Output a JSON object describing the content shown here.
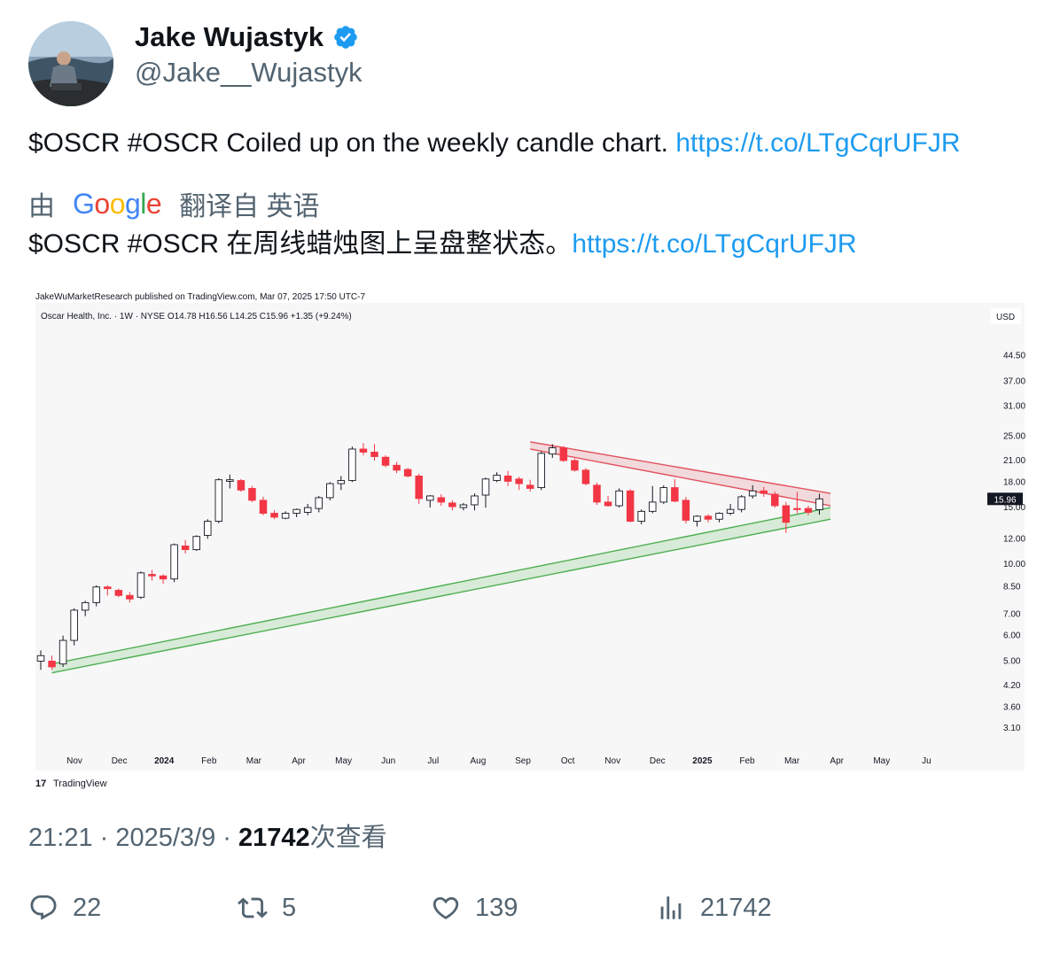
{
  "author": {
    "name": "Jake Wujastyk",
    "handle": "@Jake__Wujastyk",
    "verified": true,
    "avatar_icon": "profile-photo"
  },
  "tweet": {
    "text": "$OSCR #OSCR Coiled up on the weekly candle chart. ",
    "link": "https://t.co/LTgCqrUFJR"
  },
  "translation": {
    "prefix": "由",
    "provider": "Google",
    "suffix": "翻译自 英语",
    "text": "$OSCR #OSCR 在周线蜡烛图上呈盘整状态。",
    "link": "https://t.co/LTgCqrUFJR"
  },
  "chart_data": {
    "type": "candlestick",
    "publisher_line": "JakeWuMarketResearch published on TradingView.com, Mar 07, 2025 17:50 UTC-7",
    "symbol_line": "Oscar Health, Inc. · 1W · NYSE  O14.78  H16.56  L14.25  C15.96  +1.35 (+9.24%)",
    "currency": "USD",
    "last_price_label": "15.96",
    "y_scale": "log",
    "ylim": [
      2.8,
      55
    ],
    "y_ticks": [
      "44.50",
      "37.00",
      "31.00",
      "25.00",
      "21.00",
      "18.00",
      "15.00",
      "12.00",
      "10.00",
      "8.50",
      "7.00",
      "6.00",
      "5.00",
      "4.20",
      "3.60",
      "3.10"
    ],
    "x_ticks": [
      "Nov",
      "Dec",
      "2024",
      "Feb",
      "Mar",
      "Apr",
      "May",
      "Jun",
      "Jul",
      "Aug",
      "Sep",
      "Oct",
      "Nov",
      "Dec",
      "2025",
      "Feb",
      "Mar",
      "Apr",
      "May",
      "Ju"
    ],
    "candles": [
      [
        5.0,
        5.4,
        4.7,
        5.2
      ],
      [
        5.0,
        5.2,
        4.7,
        4.8
      ],
      [
        4.9,
        6.0,
        4.8,
        5.8
      ],
      [
        5.8,
        7.3,
        5.6,
        7.2
      ],
      [
        7.2,
        7.7,
        6.9,
        7.6
      ],
      [
        7.6,
        8.6,
        7.4,
        8.5
      ],
      [
        8.5,
        8.6,
        8.0,
        8.4
      ],
      [
        8.3,
        8.4,
        7.9,
        8.0
      ],
      [
        8.0,
        8.2,
        7.6,
        7.8
      ],
      [
        7.9,
        9.5,
        7.8,
        9.4
      ],
      [
        9.3,
        9.6,
        8.9,
        9.2
      ],
      [
        9.2,
        9.3,
        8.7,
        9.0
      ],
      [
        9.0,
        11.6,
        8.8,
        11.5
      ],
      [
        11.4,
        11.9,
        10.8,
        11.1
      ],
      [
        11.1,
        12.3,
        11.0,
        12.2
      ],
      [
        12.3,
        13.8,
        12.0,
        13.6
      ],
      [
        13.6,
        18.5,
        13.4,
        18.3
      ],
      [
        18.1,
        19.0,
        17.2,
        18.3
      ],
      [
        18.2,
        18.4,
        16.8,
        17.0
      ],
      [
        17.2,
        17.5,
        15.6,
        15.8
      ],
      [
        15.8,
        16.2,
        14.2,
        14.4
      ],
      [
        14.4,
        14.7,
        13.8,
        14.0
      ],
      [
        13.9,
        14.6,
        13.8,
        14.4
      ],
      [
        14.4,
        14.9,
        14.0,
        14.8
      ],
      [
        14.5,
        15.4,
        14.2,
        15.0
      ],
      [
        14.9,
        16.3,
        14.5,
        16.1
      ],
      [
        16.1,
        18.0,
        15.8,
        17.8
      ],
      [
        17.8,
        18.8,
        17.0,
        18.2
      ],
      [
        18.2,
        23.2,
        18.0,
        22.8
      ],
      [
        22.8,
        23.8,
        21.8,
        22.3
      ],
      [
        22.3,
        23.6,
        21.0,
        21.6
      ],
      [
        21.5,
        21.8,
        20.0,
        20.3
      ],
      [
        20.3,
        20.8,
        19.2,
        19.6
      ],
      [
        19.7,
        19.9,
        18.6,
        18.8
      ],
      [
        18.8,
        19.1,
        15.4,
        16.0
      ],
      [
        15.8,
        16.4,
        15.0,
        16.3
      ],
      [
        16.1,
        16.5,
        15.2,
        15.6
      ],
      [
        15.5,
        15.8,
        14.7,
        15.1
      ],
      [
        15.0,
        15.5,
        14.7,
        15.3
      ],
      [
        15.3,
        16.6,
        14.7,
        16.3
      ],
      [
        16.4,
        18.6,
        15.0,
        18.4
      ],
      [
        18.2,
        19.3,
        18.0,
        18.9
      ],
      [
        18.8,
        19.5,
        17.5,
        18.1
      ],
      [
        18.4,
        18.7,
        17.0,
        17.8
      ],
      [
        17.6,
        18.3,
        16.8,
        17.2
      ],
      [
        17.3,
        22.4,
        17.0,
        22.1
      ],
      [
        22.0,
        23.6,
        21.4,
        23.0
      ],
      [
        23.0,
        23.3,
        20.8,
        21.0
      ],
      [
        21.0,
        21.3,
        19.4,
        19.6
      ],
      [
        19.6,
        19.9,
        17.6,
        17.8
      ],
      [
        17.6,
        17.9,
        15.3,
        15.6
      ],
      [
        15.6,
        16.3,
        15.1,
        15.2
      ],
      [
        15.2,
        17.2,
        15.0,
        16.9
      ],
      [
        16.9,
        17.1,
        13.5,
        13.6
      ],
      [
        13.6,
        14.8,
        13.3,
        14.6
      ],
      [
        14.6,
        17.5,
        14.4,
        15.6
      ],
      [
        15.6,
        17.6,
        15.4,
        17.3
      ],
      [
        17.3,
        18.4,
        15.6,
        15.7
      ],
      [
        15.8,
        16.2,
        13.4,
        13.7
      ],
      [
        13.6,
        14.2,
        13.1,
        14.1
      ],
      [
        14.1,
        14.3,
        13.5,
        13.8
      ],
      [
        13.8,
        14.5,
        13.5,
        14.4
      ],
      [
        14.4,
        15.4,
        14.2,
        14.8
      ],
      [
        14.8,
        16.4,
        14.5,
        16.2
      ],
      [
        16.3,
        17.6,
        16.0,
        16.9
      ],
      [
        16.9,
        17.4,
        16.2,
        16.6
      ],
      [
        16.5,
        16.8,
        15.0,
        15.2
      ],
      [
        15.2,
        15.6,
        12.5,
        13.5
      ],
      [
        14.9,
        16.8,
        14.4,
        14.8
      ],
      [
        14.9,
        15.2,
        14.2,
        14.5
      ],
      [
        14.78,
        16.56,
        14.25,
        15.96
      ]
    ],
    "trendlines": [
      {
        "name": "",
        "color": "#e0525e",
        "upper": [
          [
            44,
            24.0
          ],
          [
            71,
            16.6
          ]
        ],
        "lower": [
          [
            44,
            22.8
          ],
          [
            71,
            15.2
          ]
        ]
      },
      {
        "name": "",
        "color": "#4caf50",
        "upper": [
          [
            1,
            4.9
          ],
          [
            71,
            15.0
          ]
        ],
        "lower": [
          [
            1,
            4.6
          ],
          [
            71,
            13.8
          ]
        ]
      }
    ],
    "footer_logo": "TradingView",
    "grid": false
  },
  "meta": {
    "time": "21:21 · 2025/3/9 · ",
    "views": "21742",
    "views_label": "次查看"
  },
  "actions": {
    "reply_count": "22",
    "retweet_count": "5",
    "like_count": "139",
    "view_count": "21742"
  },
  "colors": {
    "link": "#1d9bf0",
    "secondary_text": "#536471",
    "verified": "#1d9bf0",
    "bull_candle": "#ffffff",
    "bear_candle": "#f23645"
  }
}
